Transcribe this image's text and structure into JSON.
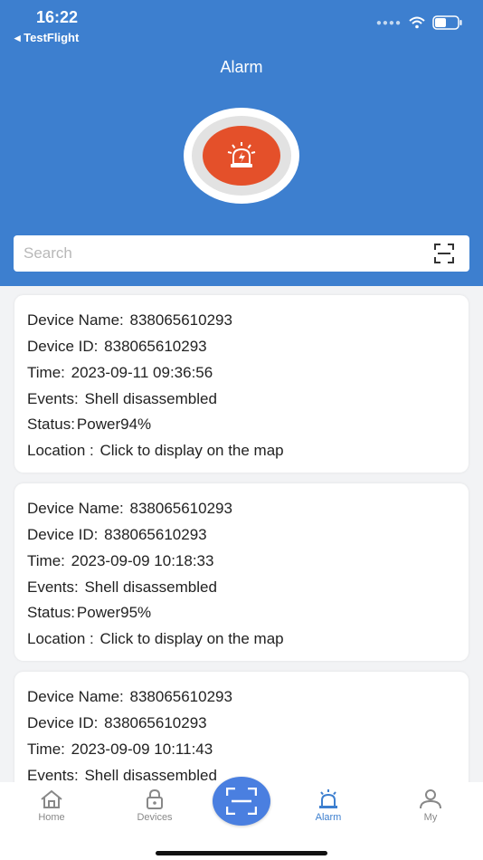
{
  "status_bar": {
    "time": "16:22",
    "back_app": "◂ TestFlight"
  },
  "header": {
    "title": "Alarm"
  },
  "search": {
    "placeholder": "Search"
  },
  "alarms": [
    {
      "device_name_label": "Device Name:",
      "device_name": "838065610293",
      "device_id_label": "Device ID:",
      "device_id": "838065610293",
      "time_label": "Time:",
      "time": "2023-09-11 09:36:56",
      "events_label": "Events:",
      "events": "Shell disassembled",
      "status_label": "Status:",
      "status": "Power94%",
      "location_label": "Location :",
      "location": "Click to display on the map"
    },
    {
      "device_name_label": "Device Name:",
      "device_name": "838065610293",
      "device_id_label": "Device ID:",
      "device_id": "838065610293",
      "time_label": "Time:",
      "time": "2023-09-09 10:18:33",
      "events_label": "Events:",
      "events": "Shell disassembled",
      "status_label": "Status:",
      "status": "Power95%",
      "location_label": "Location :",
      "location": "Click to display on the map"
    },
    {
      "device_name_label": "Device Name:",
      "device_name": "838065610293",
      "device_id_label": "Device ID:",
      "device_id": "838065610293",
      "time_label": "Time:",
      "time": "2023-09-09 10:11:43",
      "events_label": "Events:",
      "events": "Shell disassembled"
    }
  ],
  "tabs": [
    {
      "label": "Home",
      "icon": "home-icon"
    },
    {
      "label": "Devices",
      "icon": "lock-icon"
    },
    {
      "label": "Alarm",
      "icon": "alarm-icon",
      "active": true
    },
    {
      "label": "My",
      "icon": "person-icon"
    }
  ],
  "colors": {
    "primary": "#3d7fcf",
    "alarm_red": "#e4502a",
    "fab_blue": "#4a7fe0"
  }
}
